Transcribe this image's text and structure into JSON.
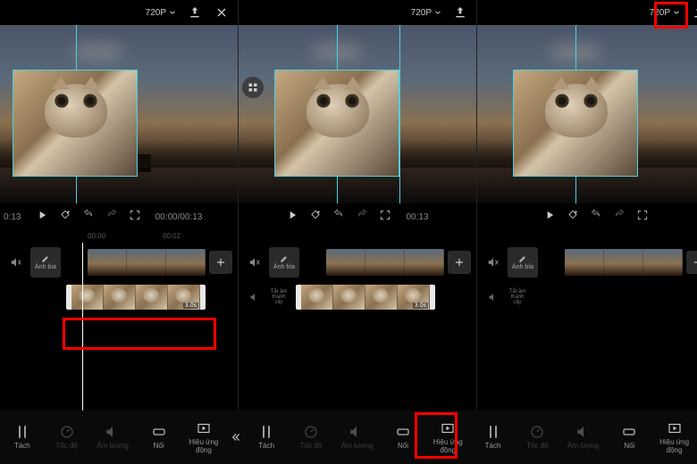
{
  "header": {
    "resolution": "720P",
    "panes": [
      {
        "show_close": true
      },
      {
        "show_close": false
      },
      {
        "show_close": false,
        "highlight_export": true
      }
    ]
  },
  "preview": {
    "left_time": "0:13",
    "timecode_full": "00:00/00:13",
    "timecode_short": "00:13"
  },
  "ruler": [
    "00:00",
    "00:02"
  ],
  "timeline": {
    "cover_label": "Ảnh bìa",
    "mute_label": "Tắt âm thanh\nclip",
    "overlay_duration": "3.0s"
  },
  "toolbar": {
    "items": [
      {
        "key": "tach",
        "label": "Tách",
        "icon": "split"
      },
      {
        "key": "tocdo",
        "label": "Tốc độ",
        "icon": "speed",
        "dim": true
      },
      {
        "key": "amluong",
        "label": "Âm lượng",
        "icon": "volume",
        "dim": true
      },
      {
        "key": "noi",
        "label": "Nối",
        "icon": "link"
      },
      {
        "key": "hieuung",
        "label": "Hiệu ứng\nđộng",
        "icon": "play-fx"
      }
    ],
    "highlight_index_pane2": 4
  },
  "highlights": {
    "overlay_clip_pane1": true,
    "export_pane3": true,
    "tool_pane2": true
  }
}
